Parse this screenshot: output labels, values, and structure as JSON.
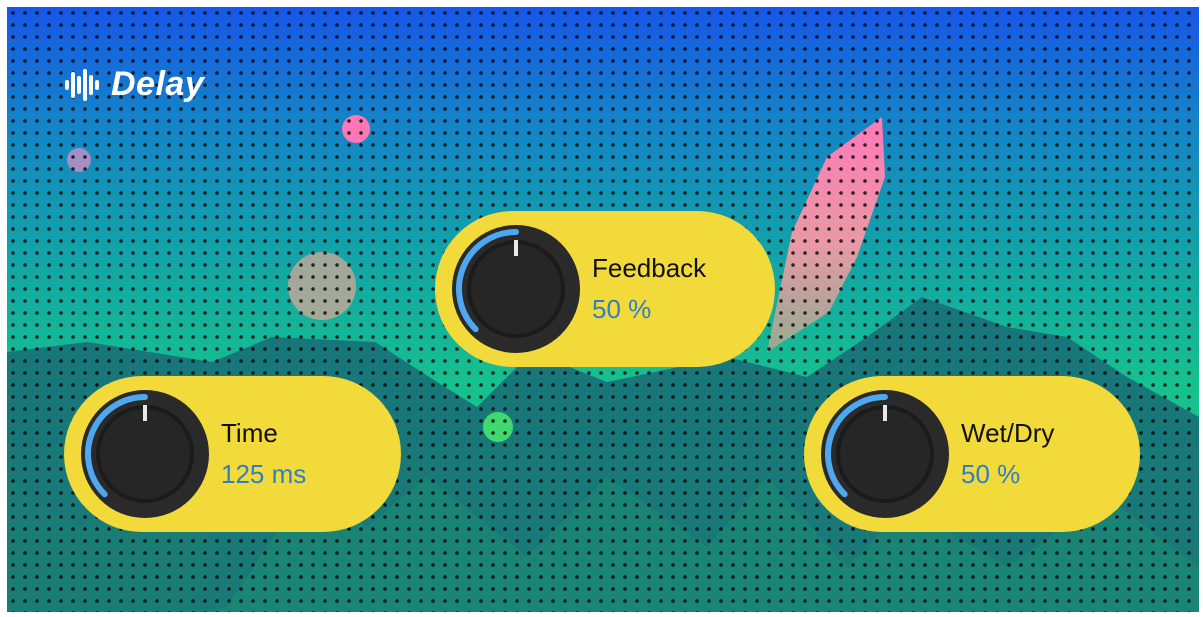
{
  "plugin": {
    "title": "Delay",
    "logo_icon": "presonus-waveform-logo-icon"
  },
  "controls": [
    {
      "id": "time",
      "label": "Time",
      "value": "125 ms",
      "position": 0.5,
      "knob_icon": "time-knob-icon"
    },
    {
      "id": "feedback",
      "label": "Feedback",
      "value": "50 %",
      "position": 0.5,
      "knob_icon": "feedback-knob-icon"
    },
    {
      "id": "wetdry",
      "label": "Wet/Dry",
      "value": "50 %",
      "position": 0.5,
      "knob_icon": "wetdry-knob-icon"
    }
  ],
  "colors": {
    "panel": "#f2da3a",
    "value_text": "#2f7fc7",
    "arc": "#4da8ef",
    "knob": "#1c1c1c"
  }
}
